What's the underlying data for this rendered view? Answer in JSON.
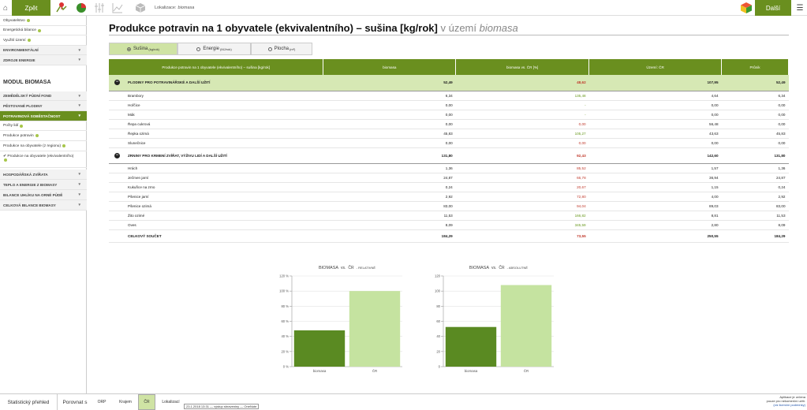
{
  "topbar": {
    "back_label": "Zpět",
    "next_label": "Další",
    "location_prefix": "Lokalizace:",
    "location_value": "biomasa",
    "icons": [
      "home-icon",
      "map-pin-icon",
      "pie-chart-icon",
      "sliders-icon",
      "line-chart-icon",
      "box-icon",
      "colored-cube-icon",
      "hamburger-menu-icon"
    ]
  },
  "sidebar": {
    "items_top": [
      {
        "label": "Obyvatelstvo",
        "dot": true
      },
      {
        "label": "Energetická bilance",
        "dot": true
      },
      {
        "label": "Využití území",
        "dot": true
      }
    ],
    "sections_top": [
      "ENVIRONMENTÁLNÍ",
      "ZDROJE ENERGIE"
    ],
    "module_title": "MODUL BIOMASA",
    "sections_mid": [
      "ZEMĚDĚLSKÝ PŮDNÍ FOND",
      "PĚSTOVANÉ PLODINY"
    ],
    "active_section": "POTRAVINOVÁ SOBĚSTAČNOST",
    "sub_items": [
      {
        "label": "Počty lidí",
        "dot": true
      },
      {
        "label": "Produkce potravin",
        "dot": true
      },
      {
        "label": "Produkce na obyvatele (z regionu)",
        "dot": true
      }
    ],
    "checked_item": "Produkce na obyvatele (ekvivalentního)",
    "sections_bottom": [
      "HOSPODÁŘSKÁ ZVÍŘATA",
      "TEPLO A ENERGIE Z BIOMASY",
      "BILANCE UHLÍKU NA ORNÉ PŮDĚ",
      "CELKOVÁ BILANCE BIOMASY"
    ]
  },
  "page": {
    "title_main": "Produkce potravin na 1 obyvatele (ekvivalentního) – sušina [kg/rok]",
    "title_gray": "v území",
    "title_italic": "biomasa"
  },
  "tabs": [
    {
      "label": "Sušina",
      "unit": "(kg/rok)",
      "selected": true
    },
    {
      "label": "Energie",
      "unit": "(MJ/rok)",
      "selected": false
    },
    {
      "label": "Plocha",
      "unit": "(m²)",
      "selected": false
    }
  ],
  "table": {
    "headers": [
      "Produkce potravin na 1 obyvatele (ekvivalentního) – sušina [kg/rok]",
      "biomasa",
      "biomasa vs. ČR [%]",
      "Území: ČR",
      "Průnik"
    ],
    "groups": [
      {
        "name": "PLODINY PRO POTRAVINÁŘSKÉ A DALŠÍ UŽITÍ",
        "values": [
          "52,49",
          "48,62",
          "107,95",
          "52,49"
        ],
        "pct_color": "red",
        "rows": [
          {
            "name": "Brambory",
            "values": [
              "6,34",
              "135,48",
              "4,64",
              "6,34"
            ],
            "pct_color": "grn"
          },
          {
            "name": "Hořčice",
            "values": [
              "0,00",
              "-",
              "0,00",
              "0,00"
            ],
            "pct_color": "grn"
          },
          {
            "name": "Mák",
            "values": [
              "0,00",
              "-",
              "0,00",
              "0,00"
            ],
            "pct_color": "grn"
          },
          {
            "name": "Řepa cukrová",
            "values": [
              "0,00",
              "0,00",
              "56,48",
              "0,00"
            ],
            "pct_color": "red"
          },
          {
            "name": "Řepka ozimá",
            "values": [
              "45,83",
              "105,27",
              "43,63",
              "45,83"
            ],
            "pct_color": "grn"
          },
          {
            "name": "Slunečnice",
            "values": [
              "0,00",
              "0,00",
              "0,00",
              "0,00"
            ],
            "pct_color": "red"
          }
        ]
      },
      {
        "name": "ZRNINY PRO KRMENÍ ZVÍŘAT, VÝŽIVU LIDÍ A DALŠÍ UŽITÍ",
        "values": [
          "131,80",
          "92,43",
          "142,60",
          "131,80"
        ],
        "pct_color": "red",
        "rows": [
          {
            "name": "Hrách",
            "values": [
              "1,36",
              "85,52",
              "1,57",
              "1,36"
            ],
            "pct_color": "red"
          },
          {
            "name": "Ječmen jarní",
            "values": [
              "24,87",
              "66,78",
              "36,94",
              "24,87"
            ],
            "pct_color": "red"
          },
          {
            "name": "Kukuřice na zrno",
            "values": [
              "0,24",
              "20,67",
              "1,15",
              "0,24"
            ],
            "pct_color": "red"
          },
          {
            "name": "Pšenice jarní",
            "values": [
              "2,92",
              "72,80",
              "4,00",
              "2,92"
            ],
            "pct_color": "red"
          },
          {
            "name": "Pšenice ozimá",
            "values": [
              "83,00",
              "94,04",
              "89,03",
              "83,00"
            ],
            "pct_color": "red"
          },
          {
            "name": "Žito ozimé",
            "values": [
              "11,53",
              "166,82",
              "8,81",
              "11,53"
            ],
            "pct_color": "grn"
          },
          {
            "name": "Oves",
            "values": [
              "8,09",
              "345,59",
              "2,80",
              "8,09"
            ],
            "pct_color": "grn"
          }
        ]
      }
    ],
    "total": {
      "name": "CELKOVÝ SOUČET",
      "values": [
        "184,29",
        "73,55",
        "250,55",
        "184,29"
      ]
    }
  },
  "chart_data": [
    {
      "type": "bar",
      "title": "BIOMASA vs. ČR - RELATIVNĚ",
      "title_parts": [
        "BIOMASA",
        "vs.",
        "ČR",
        "- RELATIVNĚ"
      ],
      "categories": [
        "biomasa",
        "ČR"
      ],
      "values": [
        48,
        100
      ],
      "ylim": [
        0,
        120
      ],
      "yticks": [
        "0 %",
        "20 %",
        "40 %",
        "60 %",
        "80 %",
        "100 %",
        "120 %"
      ],
      "colors": [
        "#5a8a22",
        "#c5e3a0"
      ],
      "grid": true
    },
    {
      "type": "bar",
      "title": "BIOMASA vs. ČR - ABSOLUTNĚ",
      "title_parts": [
        "BIOMASA",
        "vs.",
        "ČR",
        "- ABSOLUTNĚ"
      ],
      "categories": [
        "biomasa",
        "ČR"
      ],
      "values": [
        52.49,
        107.95
      ],
      "ylim": [
        0,
        120
      ],
      "yticks": [
        "0",
        "20",
        "40",
        "60",
        "80",
        "100",
        "120"
      ],
      "colors": [
        "#5a8a22",
        "#c5e3a0"
      ],
      "grid": true
    }
  ],
  "bottombar": {
    "overview_label": "Statistický přehled",
    "compare_label": "Porovnat s",
    "options": [
      "ORP",
      "Krajem",
      "ČR",
      "Lokalizací"
    ],
    "selected": "ČR",
    "tooltip": "23.1.2018 13:31 — výstup sbraveniny — OneNote",
    "version_lines": [
      "Aplikace je určena",
      "pouze pro nekomerční užití."
    ],
    "version_link": "(viz licenční podmínky)"
  }
}
